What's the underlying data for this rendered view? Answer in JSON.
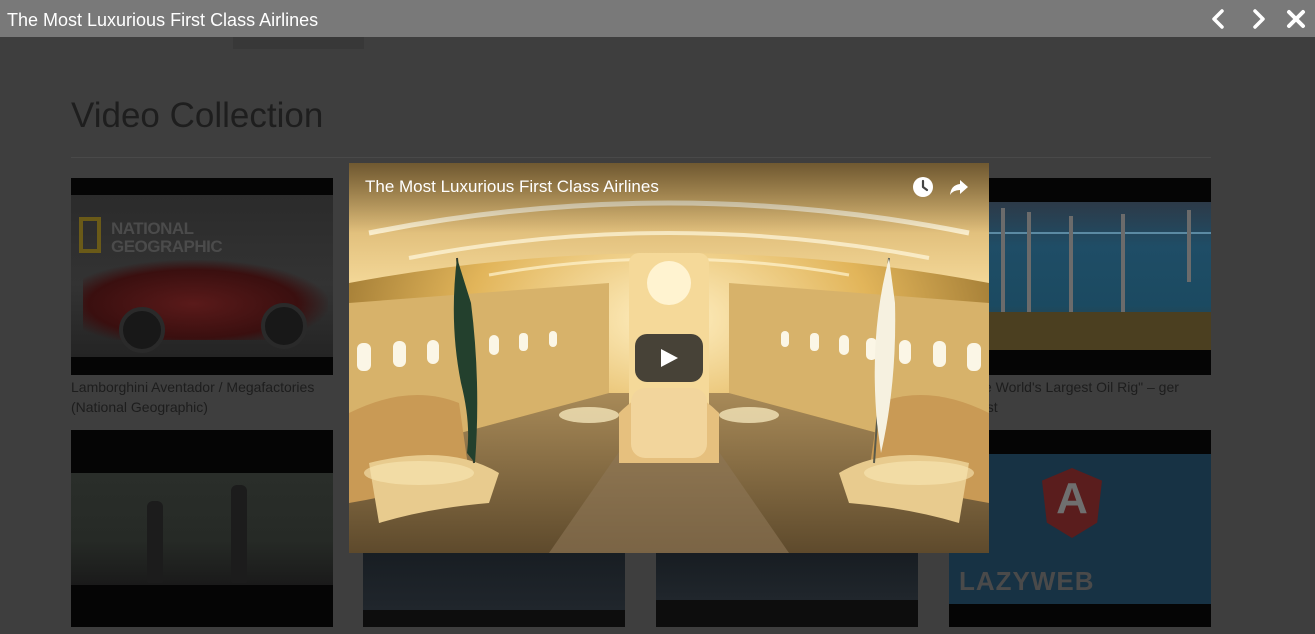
{
  "lightbox": {
    "title": "The Most Luxurious First Class Airlines",
    "prev_icon": "chevron-left-icon",
    "next_icon": "chevron-right-icon",
    "close_icon": "close-icon"
  },
  "page": {
    "heading": "Video Collection",
    "videos": [
      {
        "caption": "Lamborghini Aventador / Megafactories (National Geographic)",
        "thumb": "national-geographic-car"
      },
      {
        "caption": "",
        "thumb": "hidden"
      },
      {
        "caption": "",
        "thumb": "hidden"
      },
      {
        "caption": "g \"The World's Largest Oil Rig\" – ger Biggest",
        "thumb": "oil-rig-diagram"
      },
      {
        "caption": "",
        "thumb": "people-outdoors"
      },
      {
        "caption": "",
        "thumb": "truck"
      },
      {
        "caption": "",
        "thumb": "dark-scene"
      },
      {
        "caption": "",
        "thumb": "lazyweb-angular"
      }
    ],
    "thumb_texts": {
      "natgeo_line1": "NATIONAL",
      "natgeo_line2": "GEOGRAPHIC",
      "lazyweb": "LAZYWEB",
      "angular_letter": "A"
    }
  },
  "player": {
    "title": "The Most Luxurious First Class Airlines",
    "watch_later_icon": "clock-icon",
    "share_icon": "share-icon",
    "play_icon": "play-icon"
  },
  "colors": {
    "overlay_bg": "#3e3e3e",
    "header_bg": "#797979",
    "player_tint": "#c9a24a"
  }
}
